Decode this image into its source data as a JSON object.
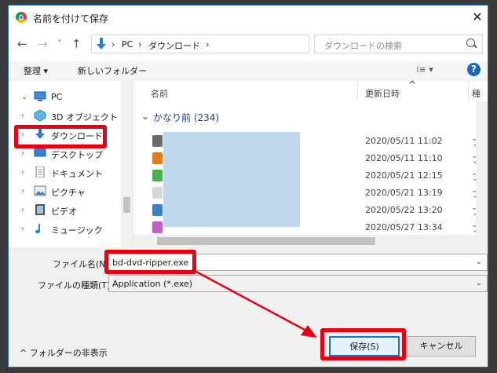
{
  "window": {
    "title": "名前を付けて保存",
    "close_glyph": "✕"
  },
  "address": {
    "back_glyph": "←",
    "forward_glyph": "→",
    "recent_glyph": "˅",
    "up_glyph": "↑",
    "crumbs": [
      "PC",
      "ダウンロード"
    ],
    "separator": "›",
    "dropdown_glyph": "˅",
    "refresh_glyph": "↻"
  },
  "search": {
    "placeholder": "ダウンロードの検索"
  },
  "toolbar": {
    "organize": "整理 ▾",
    "new_folder": "新しいフォルダー",
    "view_glyph": "⁞≡ ▾",
    "help": "?"
  },
  "nav": {
    "items": [
      {
        "label": "PC",
        "icon": "pc-icon",
        "chevron": "⌄"
      },
      {
        "label": "3D オブジェクト",
        "icon": "3d-objects-icon",
        "chevron": "›"
      },
      {
        "label": "ダウンロード",
        "icon": "download-icon",
        "chevron": "›"
      },
      {
        "label": "デスクトップ",
        "icon": "desktop-icon",
        "chevron": "›"
      },
      {
        "label": "ドキュメント",
        "icon": "document-icon",
        "chevron": "›"
      },
      {
        "label": "ピクチャ",
        "icon": "picture-icon",
        "chevron": "›"
      },
      {
        "label": "ビデオ",
        "icon": "video-icon",
        "chevron": "›"
      },
      {
        "label": "ミュージック",
        "icon": "music-icon",
        "chevron": "›"
      }
    ]
  },
  "list": {
    "columns": [
      "名前",
      "更新日時",
      "種"
    ],
    "sort_glyph": "^",
    "group_label": "かなり前 (234)",
    "group_chevron": "⌄",
    "rows": [
      {
        "date": "2020/05/11 11:02",
        "type": "フ",
        "color": "#6b6b6b"
      },
      {
        "date": "2020/05/11 11:10",
        "type": "フ",
        "color": "#e07b22"
      },
      {
        "date": "2020/05/21 12:15",
        "type": "フ",
        "color": "#4caf50"
      },
      {
        "date": "2020/05/21 13:19",
        "type": "フ",
        "color": "#d7d7d7"
      },
      {
        "date": "2020/05/22 13:20",
        "type": "フ",
        "color": "#3b82c4"
      },
      {
        "date": "2020/05/27 13:34",
        "type": "フ",
        "color": "#c25ec4"
      }
    ]
  },
  "form": {
    "filename_label": "ファイル名(N):",
    "filename_value": "bd-dvd-ripper.exe",
    "filetype_label": "ファイルの種類(T):",
    "filetype_value": "Application (*.exe)",
    "caret": "⌄"
  },
  "footer": {
    "hide_folders": "^ フォルダーの非表示",
    "save": "保存(S)",
    "cancel": "キャンセル"
  },
  "colors": {
    "highlight": "#e60012",
    "accent": "#0078d7"
  }
}
